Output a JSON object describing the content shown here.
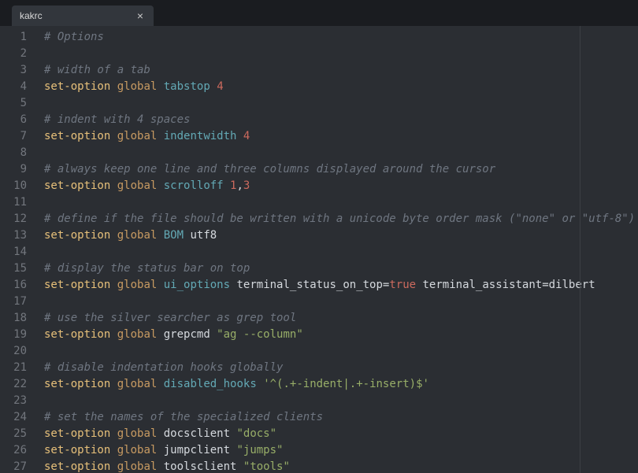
{
  "tab": {
    "title": "kakrc"
  },
  "lines": [
    {
      "n": 1,
      "t": [
        {
          "c": "cmt",
          "s": "# Options"
        }
      ]
    },
    {
      "n": 2,
      "t": []
    },
    {
      "n": 3,
      "t": [
        {
          "c": "cmt",
          "s": "# width of a tab"
        }
      ]
    },
    {
      "n": 4,
      "t": [
        {
          "c": "kw",
          "s": "set-option"
        },
        {
          "c": "txt",
          "s": " "
        },
        {
          "c": "gl",
          "s": "global"
        },
        {
          "c": "txt",
          "s": " "
        },
        {
          "c": "opt",
          "s": "tabstop"
        },
        {
          "c": "txt",
          "s": " "
        },
        {
          "c": "num",
          "s": "4"
        }
      ]
    },
    {
      "n": 5,
      "t": []
    },
    {
      "n": 6,
      "t": [
        {
          "c": "cmt",
          "s": "# indent with 4 spaces"
        }
      ]
    },
    {
      "n": 7,
      "t": [
        {
          "c": "kw",
          "s": "set-option"
        },
        {
          "c": "txt",
          "s": " "
        },
        {
          "c": "gl",
          "s": "global"
        },
        {
          "c": "txt",
          "s": " "
        },
        {
          "c": "opt",
          "s": "indentwidth"
        },
        {
          "c": "txt",
          "s": " "
        },
        {
          "c": "num",
          "s": "4"
        }
      ]
    },
    {
      "n": 8,
      "t": []
    },
    {
      "n": 9,
      "t": [
        {
          "c": "cmt",
          "s": "# always keep one line and three columns displayed around the cursor"
        }
      ]
    },
    {
      "n": 10,
      "t": [
        {
          "c": "kw",
          "s": "set-option"
        },
        {
          "c": "txt",
          "s": " "
        },
        {
          "c": "gl",
          "s": "global"
        },
        {
          "c": "txt",
          "s": " "
        },
        {
          "c": "opt",
          "s": "scrolloff"
        },
        {
          "c": "txt",
          "s": " "
        },
        {
          "c": "num",
          "s": "1"
        },
        {
          "c": "txt",
          "s": ","
        },
        {
          "c": "num",
          "s": "3"
        }
      ]
    },
    {
      "n": 11,
      "t": []
    },
    {
      "n": 12,
      "t": [
        {
          "c": "cmt",
          "s": "# define if the file should be written with a unicode byte order mask (\"none\" or \"utf-8\")"
        }
      ]
    },
    {
      "n": 13,
      "t": [
        {
          "c": "kw",
          "s": "set-option"
        },
        {
          "c": "txt",
          "s": " "
        },
        {
          "c": "gl",
          "s": "global"
        },
        {
          "c": "txt",
          "s": " "
        },
        {
          "c": "opt",
          "s": "BOM"
        },
        {
          "c": "txt",
          "s": " utf8"
        }
      ]
    },
    {
      "n": 14,
      "t": []
    },
    {
      "n": 15,
      "t": [
        {
          "c": "cmt",
          "s": "# display the status bar on top"
        }
      ]
    },
    {
      "n": 16,
      "t": [
        {
          "c": "kw",
          "s": "set-option"
        },
        {
          "c": "txt",
          "s": " "
        },
        {
          "c": "gl",
          "s": "global"
        },
        {
          "c": "txt",
          "s": " "
        },
        {
          "c": "opt",
          "s": "ui_options"
        },
        {
          "c": "txt",
          "s": " terminal_status_on_top="
        },
        {
          "c": "bool",
          "s": "true"
        },
        {
          "c": "txt",
          "s": " terminal_assistant=dilbert"
        }
      ]
    },
    {
      "n": 17,
      "t": []
    },
    {
      "n": 18,
      "t": [
        {
          "c": "cmt",
          "s": "# use the silver searcher as grep tool"
        }
      ]
    },
    {
      "n": 19,
      "t": [
        {
          "c": "kw",
          "s": "set-option"
        },
        {
          "c": "txt",
          "s": " "
        },
        {
          "c": "gl",
          "s": "global"
        },
        {
          "c": "txt",
          "s": " grepcmd "
        },
        {
          "c": "str",
          "s": "\"ag --column\""
        }
      ]
    },
    {
      "n": 20,
      "t": []
    },
    {
      "n": 21,
      "t": [
        {
          "c": "cmt",
          "s": "# disable indentation hooks globally"
        }
      ]
    },
    {
      "n": 22,
      "t": [
        {
          "c": "kw",
          "s": "set-option"
        },
        {
          "c": "txt",
          "s": " "
        },
        {
          "c": "gl",
          "s": "global"
        },
        {
          "c": "txt",
          "s": " "
        },
        {
          "c": "opt",
          "s": "disabled_hooks"
        },
        {
          "c": "txt",
          "s": " "
        },
        {
          "c": "str",
          "s": "'^(.+-indent|.+-insert)$'"
        }
      ]
    },
    {
      "n": 23,
      "t": []
    },
    {
      "n": 24,
      "t": [
        {
          "c": "cmt",
          "s": "# set the names of the specialized clients"
        }
      ]
    },
    {
      "n": 25,
      "t": [
        {
          "c": "kw",
          "s": "set-option"
        },
        {
          "c": "txt",
          "s": " "
        },
        {
          "c": "gl",
          "s": "global"
        },
        {
          "c": "txt",
          "s": " docsclient "
        },
        {
          "c": "str",
          "s": "\"docs\""
        }
      ]
    },
    {
      "n": 26,
      "t": [
        {
          "c": "kw",
          "s": "set-option"
        },
        {
          "c": "txt",
          "s": " "
        },
        {
          "c": "gl",
          "s": "global"
        },
        {
          "c": "txt",
          "s": " jumpclient "
        },
        {
          "c": "str",
          "s": "\"jumps\""
        }
      ]
    },
    {
      "n": 27,
      "t": [
        {
          "c": "kw",
          "s": "set-option"
        },
        {
          "c": "txt",
          "s": " "
        },
        {
          "c": "gl",
          "s": "global"
        },
        {
          "c": "txt",
          "s": " toolsclient "
        },
        {
          "c": "str",
          "s": "\"tools\""
        }
      ]
    }
  ]
}
